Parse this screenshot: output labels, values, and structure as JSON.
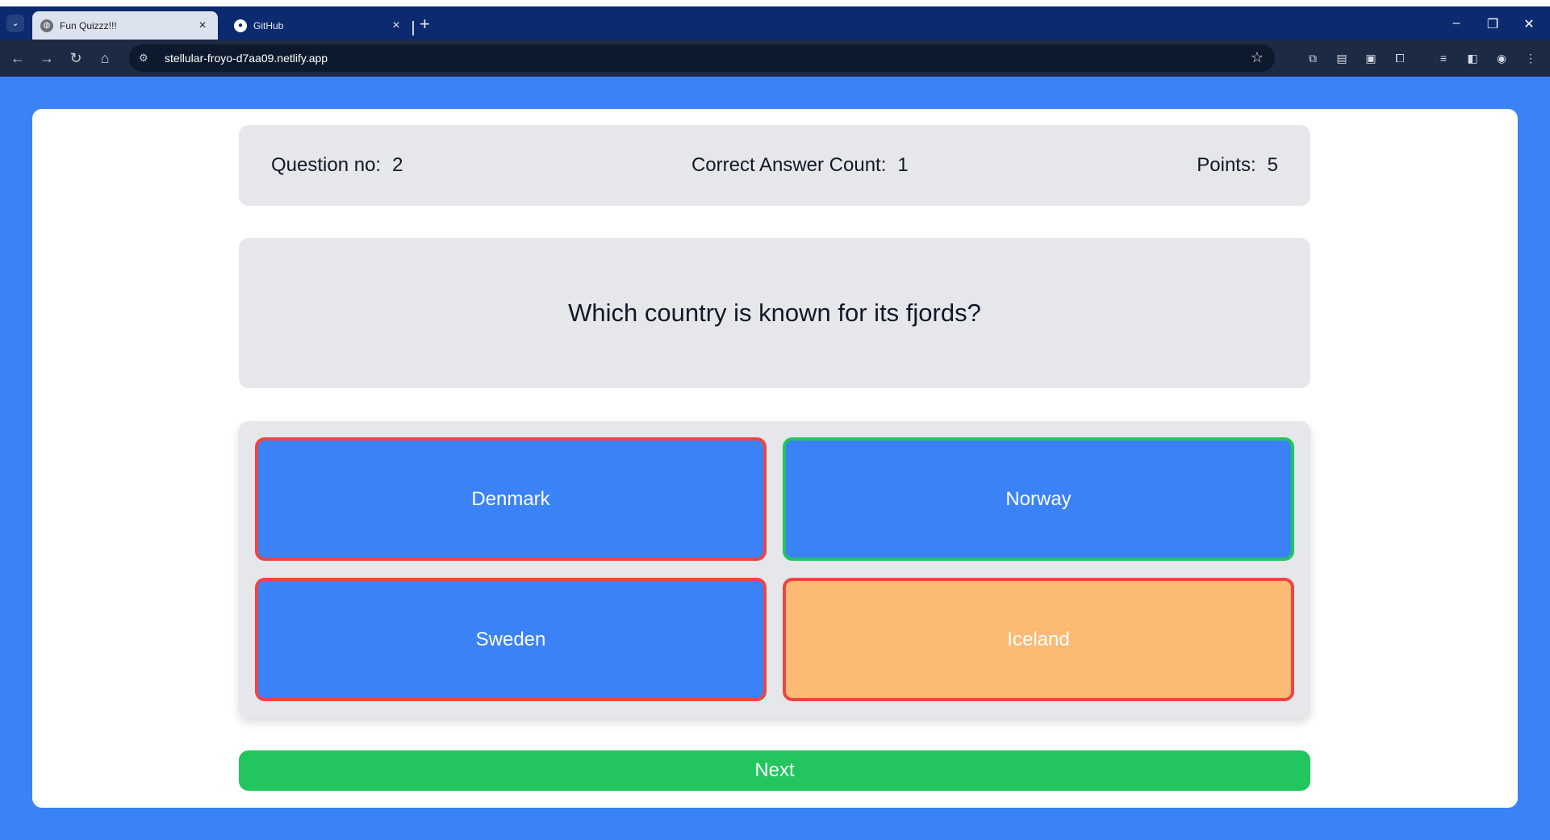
{
  "browser": {
    "tabs": [
      {
        "title": "Fun Quizzz!!!",
        "active": true,
        "close": "×"
      },
      {
        "title": "GitHub",
        "active": false,
        "close": "×"
      }
    ],
    "new_tab": "+",
    "url": "stellular-froyo-d7aa09.netlify.app",
    "window_controls": {
      "minimize": "–",
      "restore": "❐",
      "close": "✕"
    },
    "icons": [
      "back-icon",
      "forward-icon",
      "reload-icon",
      "home-icon",
      "site-info-icon",
      "bookmark-star-icon",
      "translate-icon",
      "extension-icon",
      "media-icon",
      "puzzle-icon",
      "reading-list-icon",
      "side-panel-icon",
      "profile-avatar",
      "menu-icon"
    ]
  },
  "quiz": {
    "stats": {
      "question_label": "Question no:",
      "question_value": "2",
      "correct_label": "Correct Answer Count:",
      "correct_value": "1",
      "points_label": "Points:",
      "points_value": "5"
    },
    "question": "Which country is known for its fjords?",
    "options": [
      {
        "label": "Denmark",
        "state": "wrong"
      },
      {
        "label": "Norway",
        "state": "correct"
      },
      {
        "label": "Sweden",
        "state": "wrong"
      },
      {
        "label": "Iceland",
        "state": "selected-wrong"
      }
    ],
    "next_label": "Next"
  },
  "colors": {
    "page_bg": "#3b82f6",
    "panel_bg": "#e5e7eb",
    "option_bg": "#3b82f6",
    "selected_bg": "#fdba74",
    "wrong_border": "#ef4444",
    "correct_border": "#22c55e",
    "next_bg": "#22c55e"
  }
}
